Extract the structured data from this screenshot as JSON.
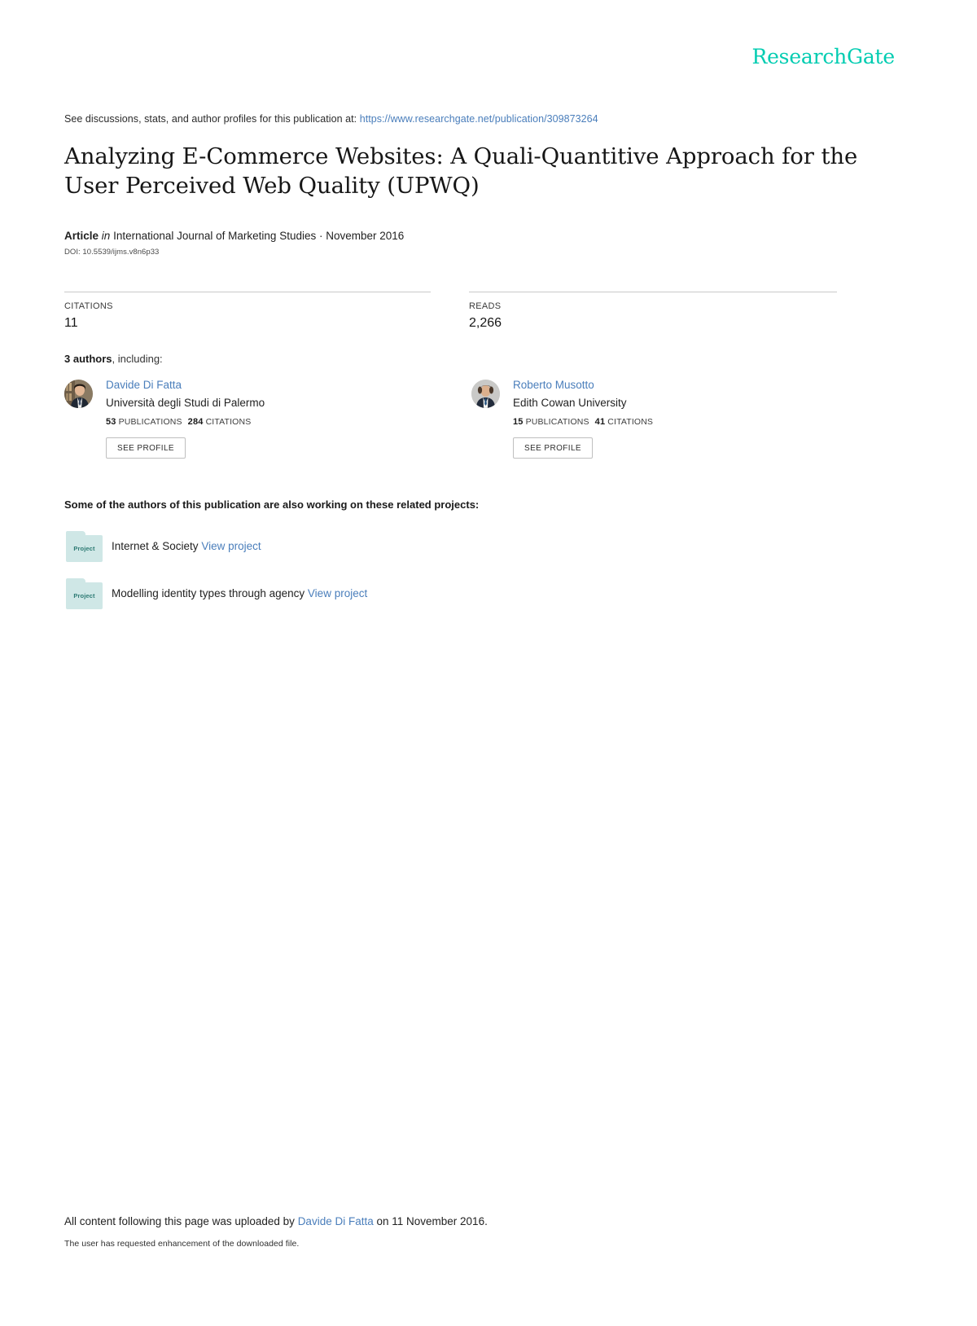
{
  "header": {
    "logo_text": "ResearchGate",
    "logo_color": "#00ccb1"
  },
  "discussion": {
    "prefix": "See discussions, stats, and author profiles for this publication at:",
    "url": "https://www.researchgate.net/publication/309873264"
  },
  "publication": {
    "title": "Analyzing E-Commerce Websites: A Quali-Quantitive Approach for the User Perceived Web Quality (UPWQ)",
    "type_label": "Article",
    "in_label": "in",
    "venue": "International Journal of Marketing Studies · November 2016",
    "doi": "DOI: 10.5539/ijms.v8n6p33"
  },
  "stats": [
    {
      "label": "CITATIONS",
      "value": "11"
    },
    {
      "label": "READS",
      "value": "2,266"
    }
  ],
  "authors_header": {
    "count_text": "3 authors",
    "rest_text": ", including:"
  },
  "authors": [
    {
      "name": "Davide Di Fatta",
      "affiliation": "Università degli Studi di Palermo",
      "publications_count": "53",
      "publications_label": "PUBLICATIONS",
      "citations_count": "284",
      "citations_label": "CITATIONS",
      "button_label": "SEE PROFILE"
    },
    {
      "name": "Roberto Musotto",
      "affiliation": "Edith Cowan University",
      "publications_count": "15",
      "publications_label": "PUBLICATIONS",
      "citations_count": "41",
      "citations_label": "CITATIONS",
      "button_label": "SEE PROFILE"
    }
  ],
  "projects_section": {
    "heading": "Some of the authors of this publication are also working on these related projects:",
    "folder_label": "Project",
    "view_label": "View project"
  },
  "projects": [
    {
      "name": "Internet & Society"
    },
    {
      "name": "Modelling identity types through agency"
    }
  ],
  "footer": {
    "upload_prefix": "All content following this page was uploaded by ",
    "upload_author": "Davide Di Fatta",
    "upload_suffix": " on 11 November 2016.",
    "enhancement_note": "The user has requested enhancement of the downloaded file."
  }
}
